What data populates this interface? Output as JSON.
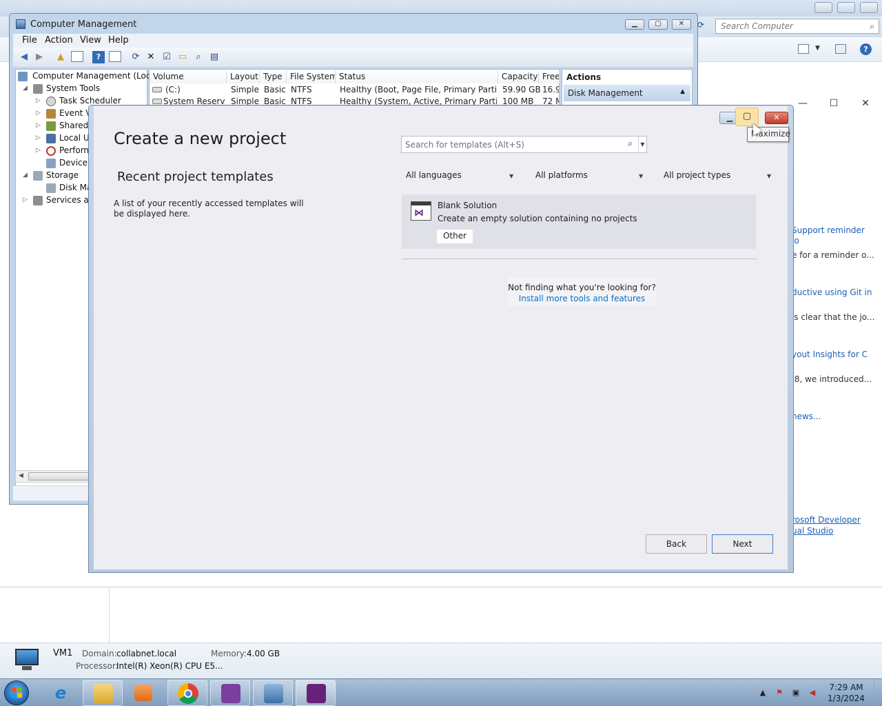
{
  "background_window": {
    "search_placeholder": "Search Computer",
    "links": [
      "Support reminder",
      "io",
      "e for a reminder o...",
      "ductive using Git in",
      "'s clear that the jo...",
      "yout Insights for C",
      ".8, we introduced...",
      "news...",
      "rosoft Developer",
      "ual Studio"
    ]
  },
  "details_pane": {
    "computer_name": "VM1",
    "domain_label": "Domain:",
    "domain_value": "collabnet.local",
    "memory_label": "Memory:",
    "memory_value": "4.00 GB",
    "processor_label": "Processor:",
    "processor_value": "Intel(R) Xeon(R) CPU E5..."
  },
  "taskbar": {
    "time": "7:29 AM",
    "date": "1/3/2024"
  },
  "computer_management": {
    "title": "Computer Management",
    "menu": [
      "File",
      "Action",
      "View",
      "Help"
    ],
    "tree": [
      "Computer Management (Local",
      "System Tools",
      "Task Scheduler",
      "Event Vi",
      "Shared F",
      "Local Us",
      "Perform",
      "Device M",
      "Storage",
      "Disk Ma",
      "Services and"
    ],
    "columns": [
      "Volume",
      "Layout",
      "Type",
      "File System",
      "Status",
      "Capacity",
      "Free"
    ],
    "rows": [
      [
        "(C:)",
        "Simple",
        "Basic",
        "NTFS",
        "Healthy (Boot, Page File, Primary Partition)",
        "59.90 GB",
        "16.9("
      ],
      [
        "System Reserved",
        "Simple",
        "Basic",
        "NTFS",
        "Healthy (System, Active, Primary Partition)",
        "100 MB",
        "72 M"
      ]
    ],
    "actions_title": "Actions",
    "actions_item": "Disk Management"
  },
  "vs_dialog": {
    "title": "Create a new project",
    "recent_title": "Recent project templates",
    "recent_desc": "A list of your recently accessed templates will be displayed here.",
    "search_placeholder": "Search for templates (Alt+S)",
    "filters": [
      "All languages",
      "All platforms",
      "All project types"
    ],
    "template": {
      "name": "Blank Solution",
      "description": "Create an empty solution containing no projects",
      "tag": "Other"
    },
    "not_finding": "Not finding what you're looking for?",
    "install_link": "Install more tools and features",
    "back_label": "Back",
    "next_label": "Next",
    "tooltip": "Maximize"
  }
}
